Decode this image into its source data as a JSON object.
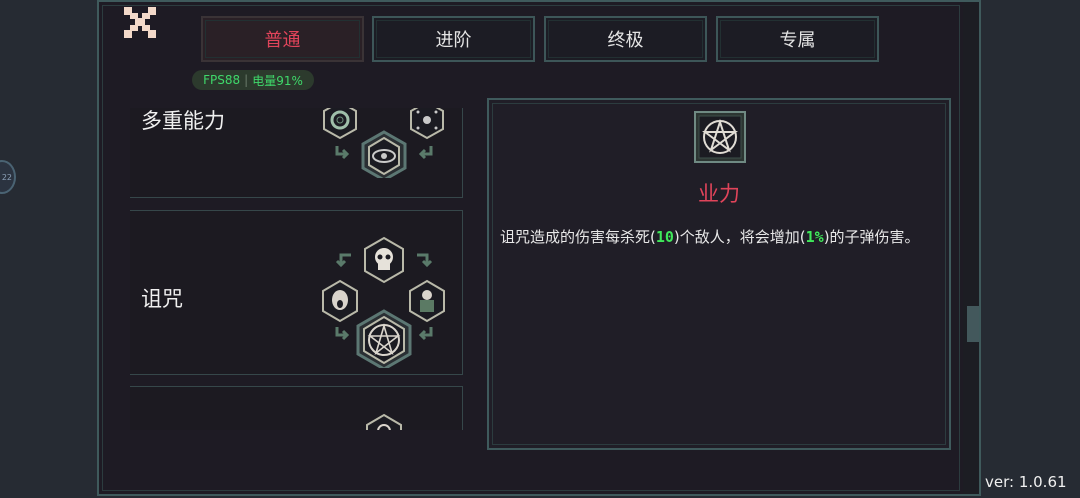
{
  "tabs": [
    {
      "label": "普通",
      "active": true
    },
    {
      "label": "进阶",
      "active": false
    },
    {
      "label": "终极",
      "active": false
    },
    {
      "label": "专属",
      "active": false
    }
  ],
  "status": {
    "fps": "FPS88",
    "battery": "电量91%"
  },
  "side_badge": "22",
  "list": {
    "items": [
      {
        "label": "多重能力"
      },
      {
        "label": "诅咒"
      }
    ]
  },
  "detail": {
    "title": "业力",
    "desc_part1": "诅咒造成的伤害每杀死(",
    "kills_value": "10",
    "desc_part2": ")个敌人，将会增加(",
    "bonus_value": "1%",
    "desc_part3": ")的子弹伤害。"
  },
  "version": "ver: 1.0.61",
  "colors": {
    "accent_red": "#e0445a",
    "highlight_green": "#3fe85a",
    "frame": "#3f5a5c"
  }
}
